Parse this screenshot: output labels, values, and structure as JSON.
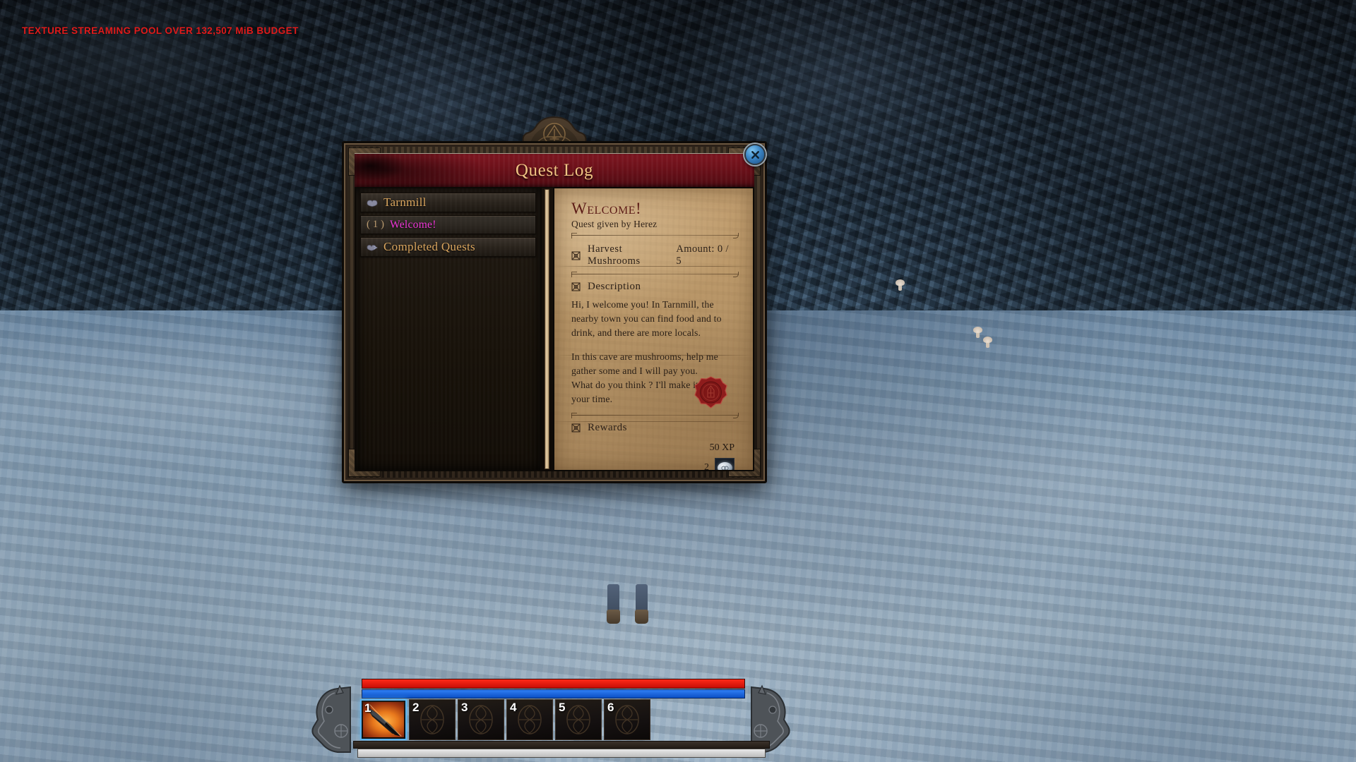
{
  "debug": {
    "overlay_text": "TEXTURE STREAMING POOL OVER 132,507 MiB BUDGET",
    "color": "#e01b1b"
  },
  "quest_window": {
    "title": "Quest Log",
    "close_icon": "close-x-icon",
    "accent_gold": "#d9a55e",
    "title_bar_color": "#6b1019",
    "parchment_color": "#b89a6c"
  },
  "quest_list": {
    "groups": [
      {
        "label": "Tarnmill",
        "icon": "shield-crest-icon",
        "type": "group",
        "expanded": true
      },
      {
        "label": "Welcome!",
        "index": "( 1 )",
        "type": "quest",
        "selected": true,
        "color": "#ef37d8"
      },
      {
        "label": "Completed Quests",
        "icon": "double-chevron-icon",
        "type": "group",
        "expanded": false
      }
    ]
  },
  "quest_detail": {
    "title": "Welcome!",
    "giver": "Quest given by Herez",
    "objective": {
      "icon": "celtic-knot-icon",
      "name": "Harvest Mushrooms",
      "amount_label": "Amount:",
      "amount_value": "0 / 5"
    },
    "description": {
      "heading": "Description",
      "icon": "celtic-knot-icon",
      "paragraphs": [
        "Hi, I welcome you! In Tarnmill, the nearby town you can find food and to drink, and there are more locals.",
        "In this cave are mushrooms, help me gather some and I will pay you.",
        "What do you think ? I'll make it worth your time."
      ]
    },
    "rewards": {
      "heading": "Rewards",
      "icon": "celtic-knot-icon",
      "xp": "50 XP",
      "items": [
        {
          "count": "2",
          "icon": "silver-coin-icon"
        }
      ],
      "seal_icon": "wax-seal-icon"
    }
  },
  "hud": {
    "health_bar": {
      "name": "health-bar",
      "color": "#e01208",
      "fill_percent": 100
    },
    "mana_bar": {
      "name": "mana-bar",
      "color": "#1a5fd6",
      "fill_percent": 100
    },
    "xp_bar": {
      "name": "experience-bar",
      "color": "#d8d8d8",
      "fill_percent": 100
    },
    "hotbar": {
      "slots": [
        {
          "key": "1",
          "selected": true,
          "item_icon": "flaming-dagger-icon",
          "empty": false
        },
        {
          "key": "2",
          "selected": false,
          "item_icon": "",
          "empty": true
        },
        {
          "key": "3",
          "selected": false,
          "item_icon": "",
          "empty": true
        },
        {
          "key": "4",
          "selected": false,
          "item_icon": "",
          "empty": true
        },
        {
          "key": "5",
          "selected": false,
          "item_icon": "",
          "empty": true
        },
        {
          "key": "6",
          "selected": false,
          "item_icon": "",
          "empty": true
        }
      ]
    }
  }
}
